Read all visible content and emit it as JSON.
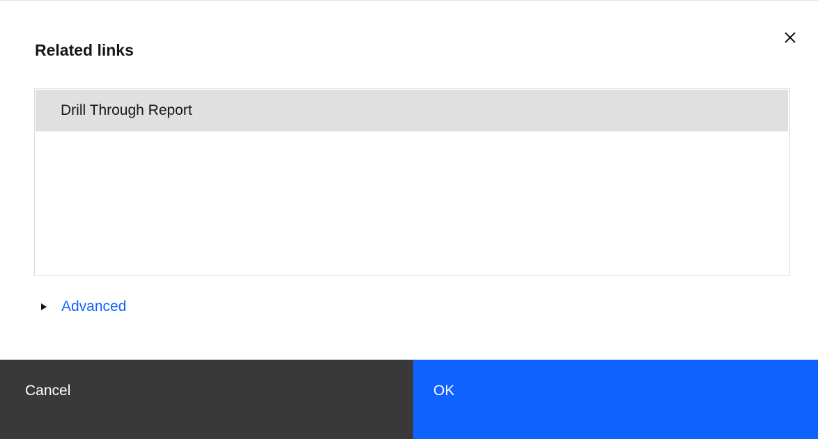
{
  "dialog": {
    "title": "Related links",
    "close_icon": "close-icon"
  },
  "links_list": {
    "items": [
      {
        "label": "Drill Through Report",
        "selected": true
      }
    ]
  },
  "advanced": {
    "label": "Advanced",
    "icon": "caret-right-icon",
    "expanded": false
  },
  "footer": {
    "cancel_label": "Cancel",
    "ok_label": "OK"
  },
  "colors": {
    "primary": "#0f62fe",
    "secondary": "#393939",
    "selected_row": "#e0e0e0",
    "text": "#161616"
  }
}
